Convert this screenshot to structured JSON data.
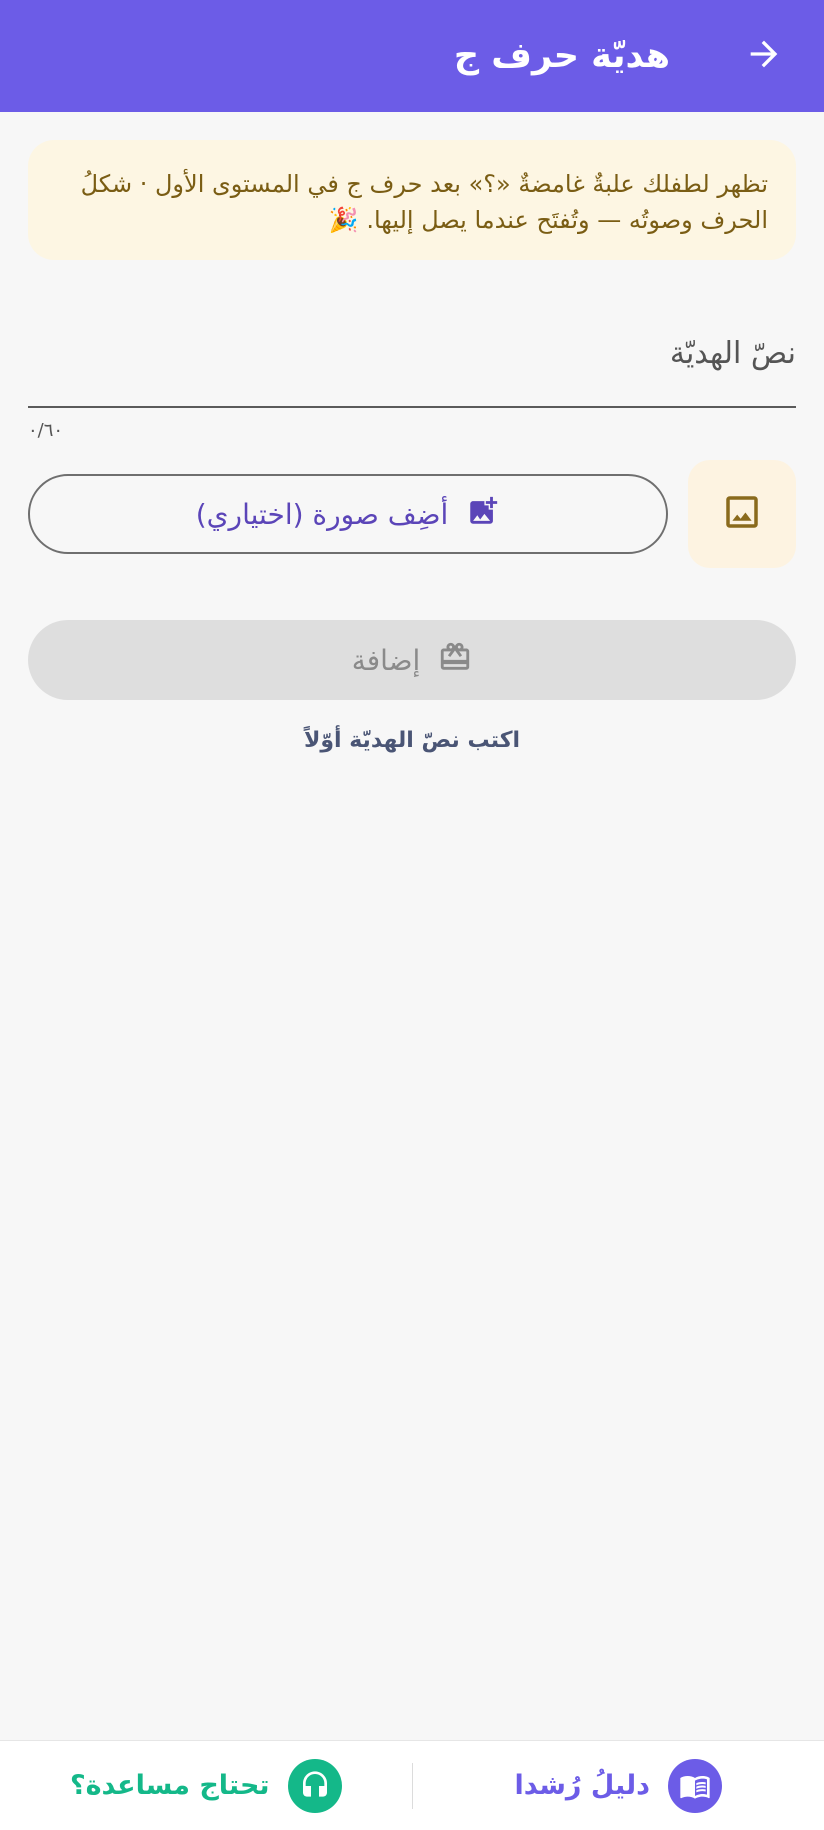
{
  "appbar": {
    "title": "هديّة حرف ج",
    "back_icon": "arrow-back-icon",
    "color": "#6c5ce7"
  },
  "banner": {
    "line1": "تظهر لطفلك علبةٌ غامضةٌ «؟» بعد حرف ج في المستوى الأول · شكلُ",
    "line2": "الحرف وصوتُه — وتُفتَح عندما يصل إليها. 🎉",
    "background": "#fdf6e3"
  },
  "gift_text_field": {
    "placeholder": "نصّ الهديّة",
    "value": "",
    "counter": "٠/٦٠"
  },
  "image_preview": {
    "icon": "image-icon"
  },
  "add_photo": {
    "label": "أضِف صورة (اختياري)",
    "icon": "add-photo-icon"
  },
  "submit": {
    "label": "إضافة",
    "icon": "gift-icon",
    "disabled": true
  },
  "hint": "اكتب نصّ الهديّة أوّلاً",
  "bottom_nav": {
    "guide_label": "دليلُ رُشدا",
    "guide_icon": "book-icon",
    "guide_color": "#6c5ce7",
    "help_label": "تحتاج مساعدة؟",
    "help_icon": "headset-icon",
    "help_color": "#14b889"
  }
}
